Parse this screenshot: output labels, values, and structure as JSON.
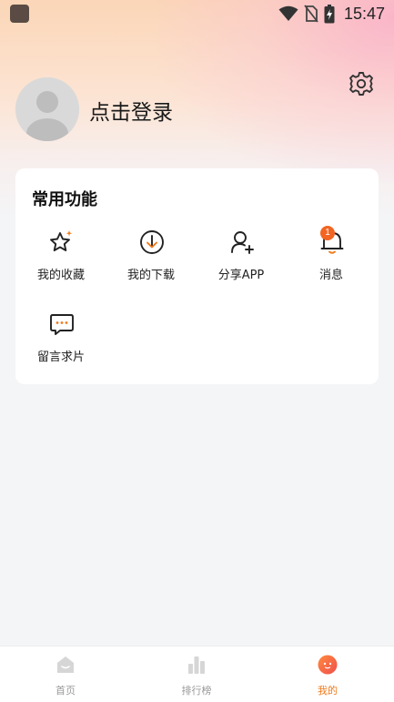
{
  "status_bar": {
    "time": "15:47"
  },
  "profile": {
    "login_label": "点击登录"
  },
  "features": {
    "title": "常用功能",
    "items": [
      {
        "label": "我的收藏",
        "icon": "star-sparkle-icon"
      },
      {
        "label": "我的下载",
        "icon": "download-icon"
      },
      {
        "label": "分享APP",
        "icon": "add-user-icon"
      },
      {
        "label": "消息",
        "icon": "bell-icon",
        "badge": "1"
      },
      {
        "label": "留言求片",
        "icon": "chat-bubble-icon"
      }
    ]
  },
  "bottom_nav": {
    "items": [
      {
        "label": "首页",
        "icon": "home-icon"
      },
      {
        "label": "排行榜",
        "icon": "ranking-icon"
      },
      {
        "label": "我的",
        "icon": "mine-face-icon",
        "active": true
      }
    ]
  },
  "colors": {
    "accent": "#f07a1a",
    "badge": "#f26522",
    "card_bg": "#ffffff",
    "page_bg": "#f4f5f7"
  }
}
